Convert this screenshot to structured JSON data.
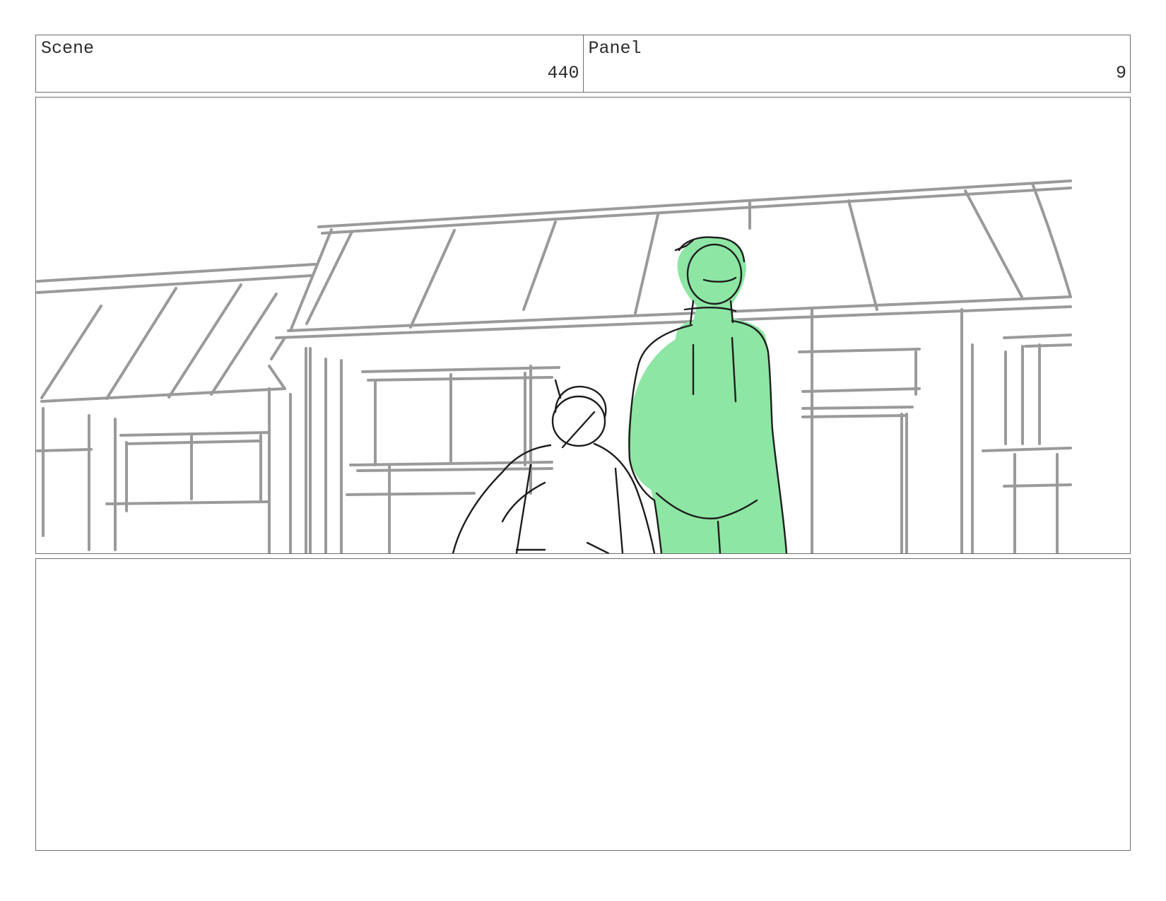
{
  "header": {
    "scene_label": "Scene",
    "scene_number": "440",
    "panel_label": "Panel",
    "panel_number": "9"
  },
  "drawing": {
    "line_color_buildings": "#9a9a9a",
    "line_color_figures": "#1e1e1e",
    "figure_fill_color": "#8ee6a4"
  },
  "notes": {
    "text": ""
  }
}
